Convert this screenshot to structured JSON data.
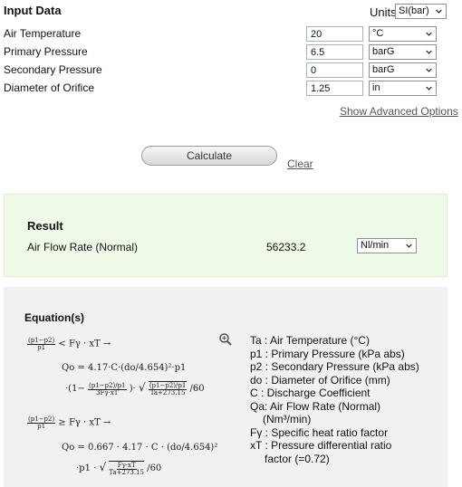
{
  "input": {
    "title": "Input Data",
    "units_label": "Units",
    "units_value": "SI(bar)",
    "rows": [
      {
        "label": "Air Temperature",
        "value": "20",
        "unit": "°C"
      },
      {
        "label": "Primary Pressure",
        "value": "6.5",
        "unit": "barG"
      },
      {
        "label": "Secondary Pressure",
        "value": "0",
        "unit": "barG"
      },
      {
        "label": "Diameter of Orifice",
        "value": "1.25",
        "unit": "in"
      }
    ],
    "advanced_link": "Show Advanced Options"
  },
  "actions": {
    "calculate": "Calculate",
    "clear": "Clear"
  },
  "result": {
    "title": "Result",
    "label": "Air Flow Rate (Normal)",
    "value": "56233.2",
    "unit": "Nl/min"
  },
  "equations": {
    "title": "Equation(s)",
    "legend": [
      "Ta : Air Temperature (°C)",
      "p1 : Primary Pressure (kPa abs)",
      "p2 : Secondary Pressure (kPa abs)",
      "do : Diameter of Orifice (mm)",
      "C  : Discharge Coefficient",
      "Qa: Air Flow Rate (Normal)",
      "(Nm³/min)",
      "Fγ : Specific heat ratio factor",
      "xT : Pressure differential ratio",
      "factor (=0.72)"
    ],
    "math": {
      "cond1_rel": "< Fγ · xT →",
      "q1_line1": "Qo = 4.17·C·(do/4.654)²·p1",
      "q1_line2": "·(1−",
      "q1_line2b": ")·",
      "q1_line2c": "/60",
      "cond2_rel": "≥ Fγ · xT →",
      "q2_line1": "Qo = 0.667 · 4.17 · C · (do/4.654)²",
      "q2_line2": "·p1 ·",
      "q2_line2c": "/60"
    }
  },
  "colors": {
    "result_bg": "#f0fae9",
    "equation_bg": "#f1f1f1"
  }
}
